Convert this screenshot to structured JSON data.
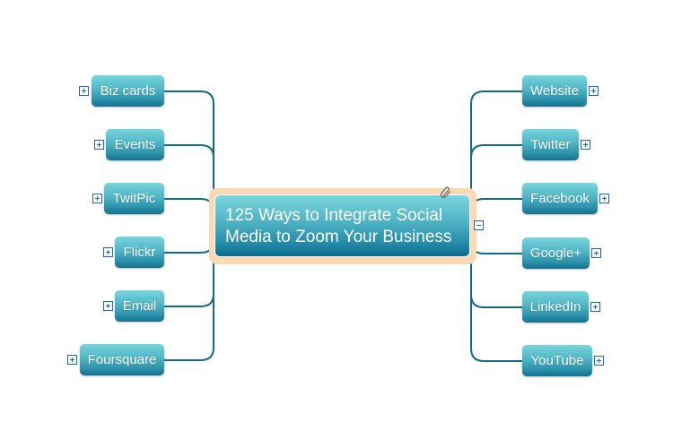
{
  "diagram": {
    "type": "mind-map",
    "colors": {
      "connector": "#0f6a8e",
      "node_top": "#78d5dc",
      "node_bottom": "#12718f",
      "center_frame": "#fbd9b4",
      "expander": "#1a66cc"
    },
    "center": {
      "line1": "125 Ways to Integrate Social",
      "line2": "Media to Zoom Your Business",
      "attachment_icon": "paperclip-icon",
      "collapse_icon": "minus-icon"
    },
    "left_branches": [
      {
        "label": "Biz cards",
        "expander": "plus-icon"
      },
      {
        "label": "Events",
        "expander": "plus-icon"
      },
      {
        "label": "TwitPic",
        "expander": "plus-icon"
      },
      {
        "label": "Flickr",
        "expander": "plus-icon"
      },
      {
        "label": "Email",
        "expander": "plus-icon"
      },
      {
        "label": "Foursquare",
        "expander": "plus-icon"
      }
    ],
    "right_branches": [
      {
        "label": "Website",
        "expander": "plus-icon"
      },
      {
        "label": "Twitter",
        "expander": "plus-icon"
      },
      {
        "label": "Facebook",
        "expander": "plus-icon"
      },
      {
        "label": "Google+",
        "expander": "plus-icon"
      },
      {
        "label": "LinkedIn",
        "expander": "plus-icon"
      },
      {
        "label": "YouTube",
        "expander": "plus-icon"
      }
    ]
  }
}
